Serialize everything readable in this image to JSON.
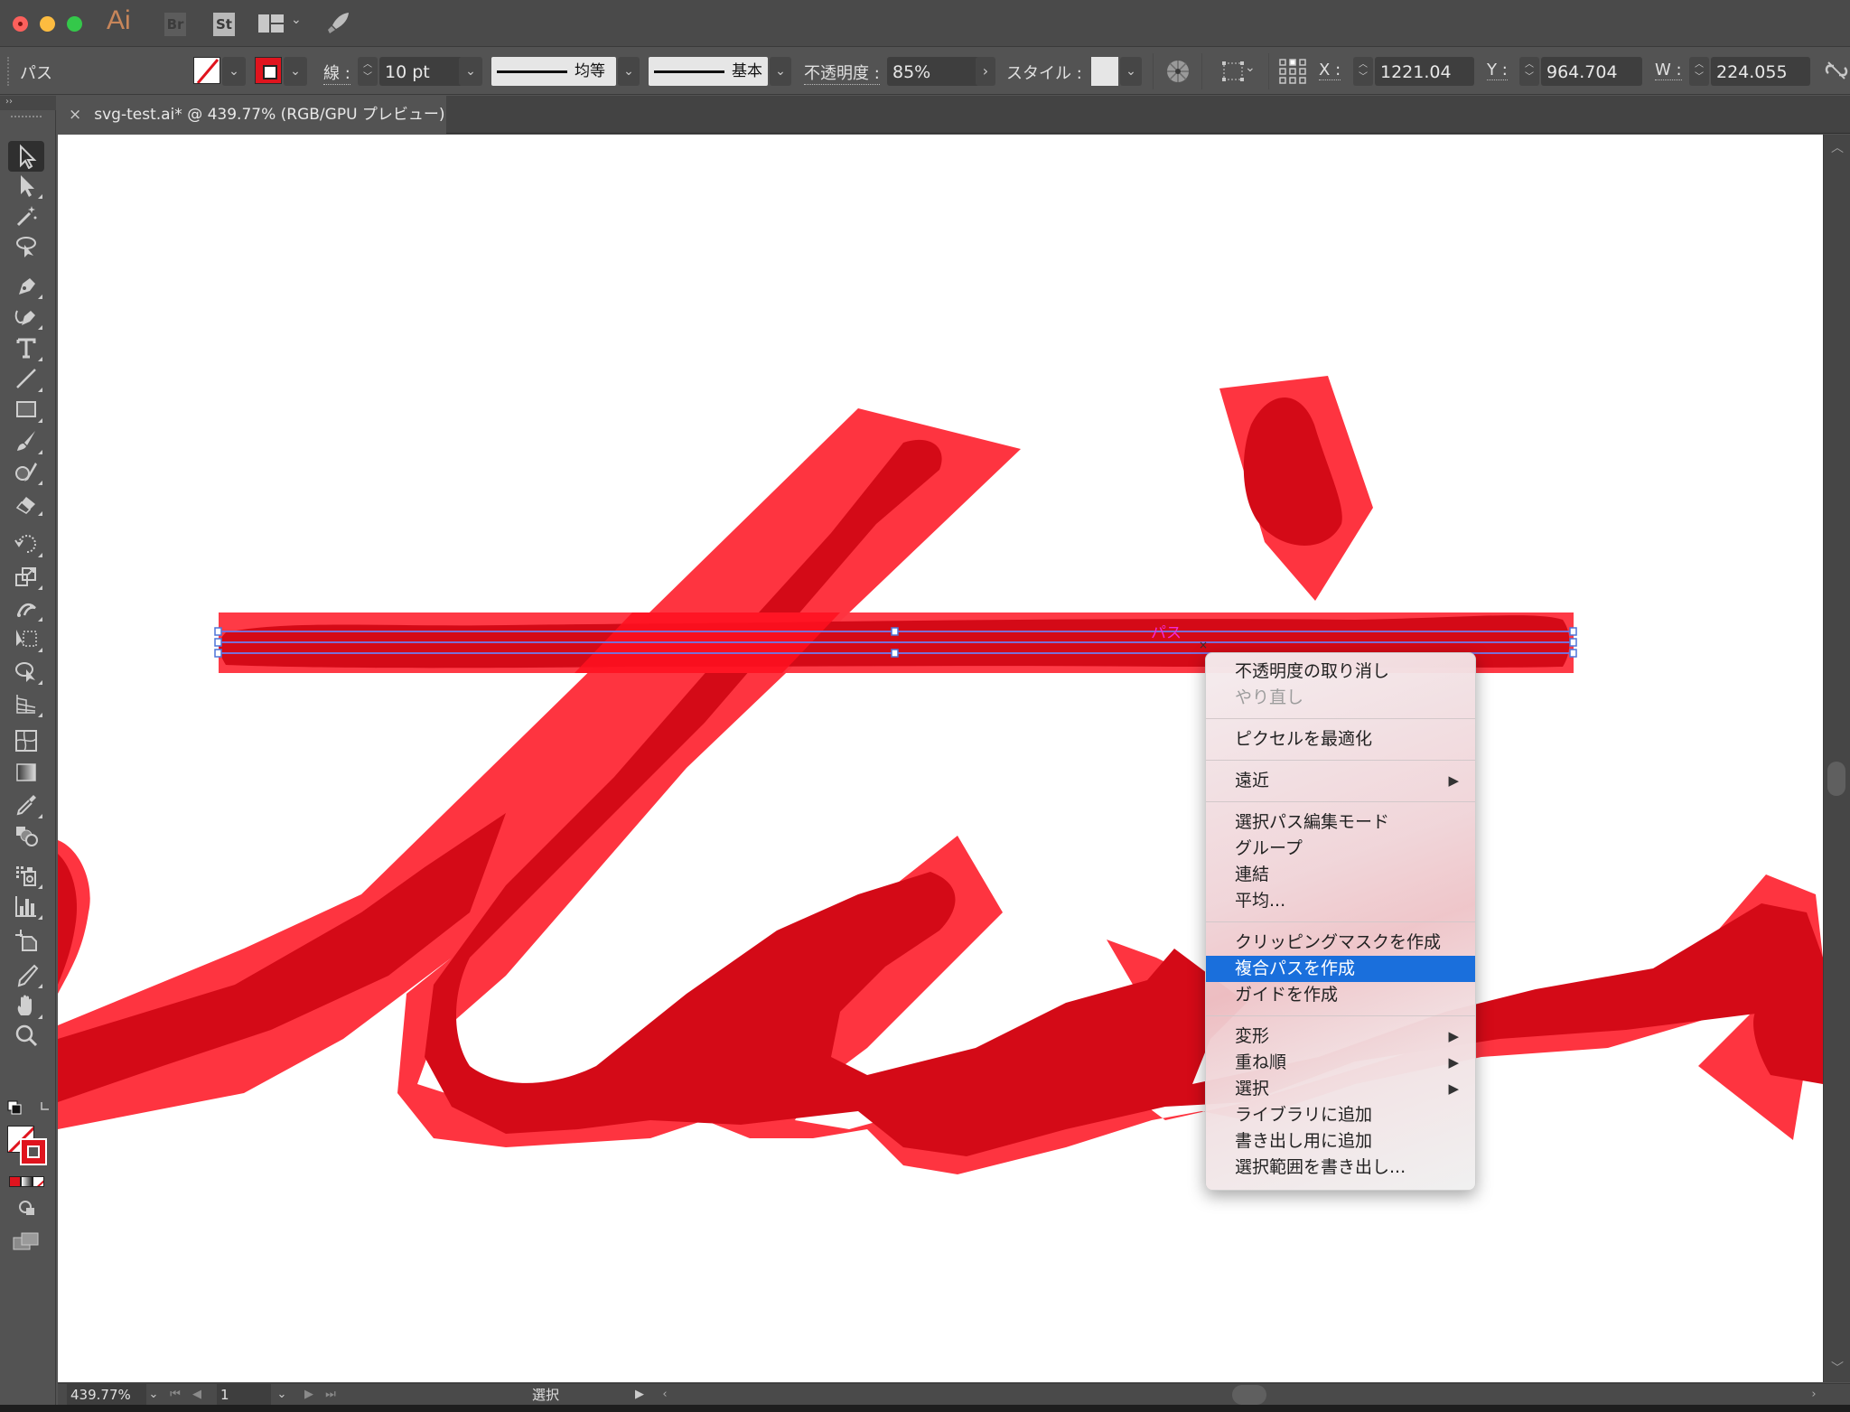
{
  "app": {
    "logo_ai": "Ai",
    "logo_br": "Br",
    "logo_st": "St"
  },
  "control_bar": {
    "selection_type": "パス",
    "stroke_label": "線",
    "stroke_weight": "10 pt",
    "variable_width_profile": "均等",
    "brush_definition": "基本",
    "opacity_label": "不透明度",
    "opacity_value": "85%",
    "style_label": "スタイル",
    "x_label": "X",
    "x_value": "1221.04 px",
    "y_label": "Y",
    "y_value": "964.704 px",
    "w_label": "W",
    "w_value": "224.055 px",
    "colors": {
      "stroke": "#e0141e"
    }
  },
  "document_tab": {
    "title": "svg-test.ai* @ 439.77% (RGB/GPU プレビュー)",
    "close": "×"
  },
  "tools_panel": {
    "collapse": "››",
    "tools": [
      {
        "name": "selection-tool",
        "active": true
      },
      {
        "name": "direct-selection-tool"
      },
      {
        "name": "magic-wand-tool"
      },
      {
        "name": "lasso-tool"
      },
      {
        "name": "pen-tool"
      },
      {
        "name": "curvature-tool"
      },
      {
        "name": "type-tool"
      },
      {
        "name": "line-segment-tool"
      },
      {
        "name": "rectangle-tool"
      },
      {
        "name": "paintbrush-tool"
      },
      {
        "name": "shaper-tool"
      },
      {
        "name": "eraser-tool"
      },
      {
        "name": "rotate-tool"
      },
      {
        "name": "scale-tool"
      },
      {
        "name": "puppet-warp-tool"
      },
      {
        "name": "free-transform-tool"
      },
      {
        "name": "shape-builder-tool"
      },
      {
        "name": "perspective-grid-tool"
      },
      {
        "name": "mesh-tool"
      },
      {
        "name": "gradient-tool"
      },
      {
        "name": "eyedropper-tool"
      },
      {
        "name": "blend-tool"
      },
      {
        "name": "symbol-sprayer-tool"
      },
      {
        "name": "column-graph-tool"
      },
      {
        "name": "artboard-tool"
      },
      {
        "name": "slice-tool"
      },
      {
        "name": "hand-tool"
      },
      {
        "name": "zoom-tool"
      }
    ]
  },
  "canvas": {
    "selected_object_label": "パス",
    "colors": {
      "outer_stroke": "#fe3440",
      "inner_stroke": "#d40a17",
      "selection": "#7b6fd6",
      "label": "#f02cd8"
    }
  },
  "context_menu": {
    "groups": [
      [
        {
          "label": "不透明度の取り消し"
        },
        {
          "label": "やり直し",
          "disabled": true
        }
      ],
      [
        {
          "label": "ピクセルを最適化"
        }
      ],
      [
        {
          "label": "遠近",
          "submenu": true
        }
      ],
      [
        {
          "label": "選択パス編集モード"
        },
        {
          "label": "グループ"
        },
        {
          "label": "連結"
        },
        {
          "label": "平均..."
        }
      ],
      [
        {
          "label": "クリッピングマスクを作成"
        },
        {
          "label": "複合パスを作成",
          "highlighted": true
        },
        {
          "label": "ガイドを作成"
        }
      ],
      [
        {
          "label": "変形",
          "submenu": true
        },
        {
          "label": "重ね順",
          "submenu": true
        },
        {
          "label": "選択",
          "submenu": true
        },
        {
          "label": "ライブラリに追加"
        },
        {
          "label": "書き出し用に追加"
        },
        {
          "label": "選択範囲を書き出し..."
        }
      ]
    ],
    "highlight_color": "#1a6fdc"
  },
  "status_bar": {
    "zoom": "439.77%",
    "artboard": "1",
    "current_tool": "選択"
  }
}
